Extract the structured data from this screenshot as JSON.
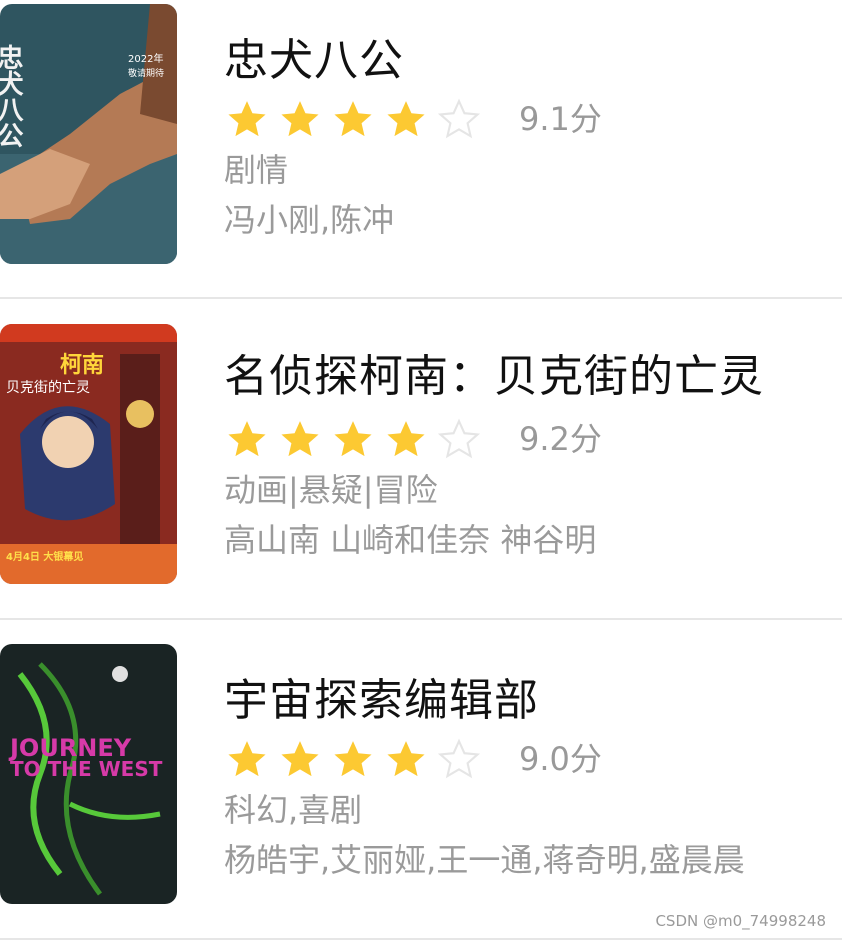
{
  "colors": {
    "star_filled": "#FCC932",
    "star_empty": "#E5E5E5",
    "title": "#111111",
    "secondary_text": "#9A9A9A",
    "divider": "#E6E6E6"
  },
  "movies": [
    {
      "title": "忠犬八公",
      "stars_filled": 4,
      "stars_total": 5,
      "score": "9.1分",
      "genre": "剧情",
      "actors": "冯小刚,陈冲",
      "poster_text": [
        "忠犬八公",
        "2022年",
        "敬请期待"
      ]
    },
    {
      "title": "名侦探柯南：贝克街的亡灵",
      "stars_filled": 4,
      "stars_total": 5,
      "score": "9.2分",
      "genre": "动画|悬疑|冒险",
      "actors": "高山南 山崎和佳奈 神谷明",
      "poster_text": [
        "柯南",
        "贝克街的亡灵",
        "4月4日 大银幕见"
      ]
    },
    {
      "title": "宇宙探索编辑部",
      "stars_filled": 4,
      "stars_total": 5,
      "score": "9.0分",
      "genre": "科幻,喜剧",
      "actors": "杨皓宇,艾丽娅,王一通,蒋奇明,盛晨晨",
      "poster_text": [
        "JOURNEY",
        "TO THE WEST"
      ]
    }
  ],
  "watermark": "CSDN @m0_74998248"
}
